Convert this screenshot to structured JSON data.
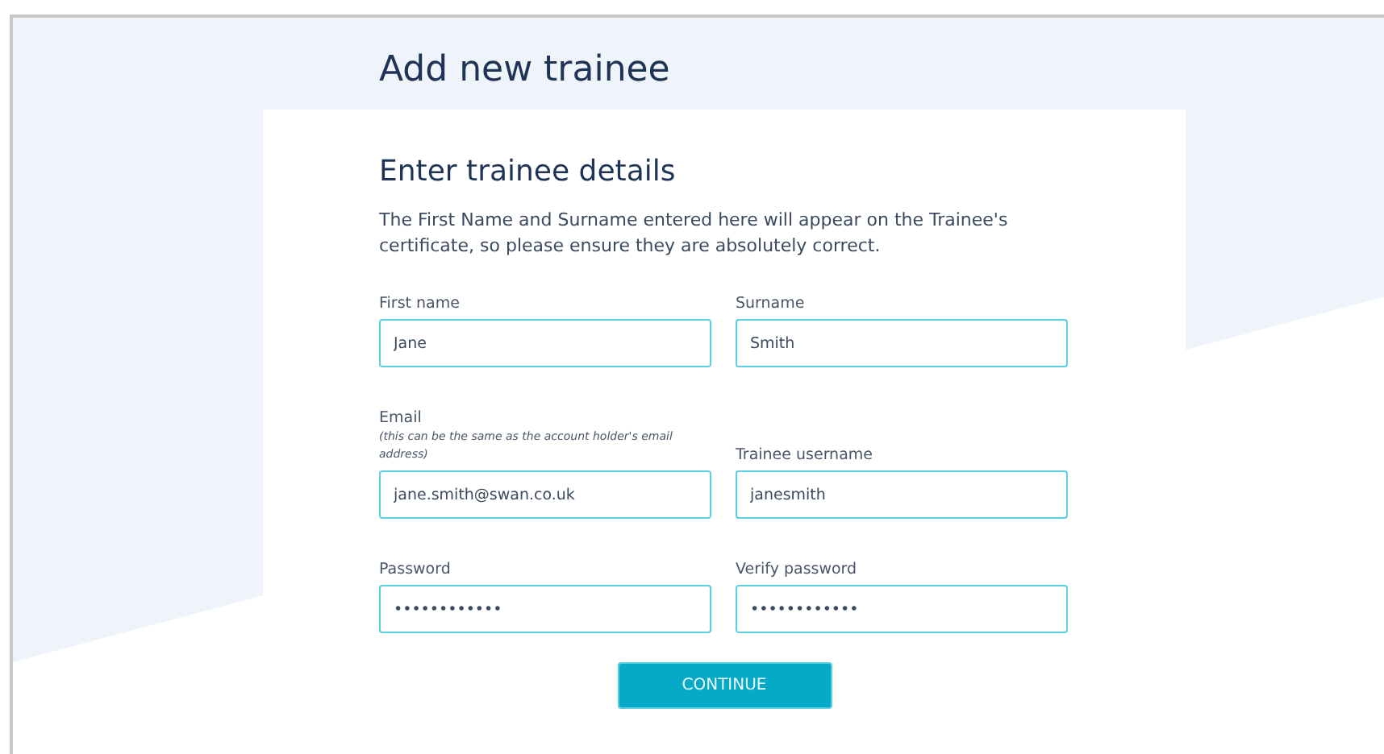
{
  "page_title": "Add new trainee",
  "form": {
    "heading": "Enter trainee details",
    "intro": "The First Name and Surname entered here will appear on the Trainee's certificate, so please ensure they are absolutely correct.",
    "fields": [
      {
        "label": "First name",
        "value": "Jane"
      },
      {
        "label": "Surname",
        "value": "Smith"
      },
      {
        "label": "Email",
        "note": "(this can be the same as the account holder's email address)",
        "value": "jane.smith@swan.co.uk"
      },
      {
        "label": "Trainee username",
        "value": "janesmith"
      },
      {
        "label": "Password",
        "value": "••••••••••••"
      },
      {
        "label": "Verify password",
        "value": "••••••••••••"
      }
    ],
    "button": "CONTINUE"
  }
}
